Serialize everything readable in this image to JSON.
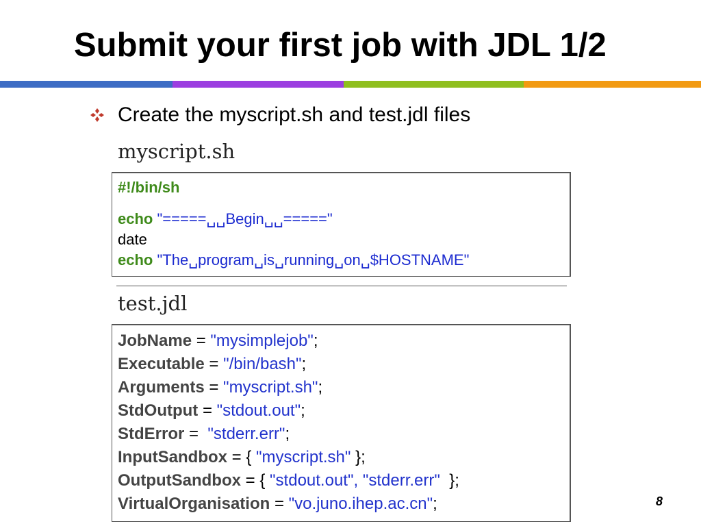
{
  "slide": {
    "title": "Submit your first job with JDL 1/2",
    "bullet": "Create the myscript.sh and test.jdl files",
    "page_number": "8"
  },
  "colors": {
    "bar_blue": "#3d6cc4",
    "bar_purple": "#9b3ee0",
    "bar_green": "#8fbf1e",
    "bar_orange": "#f29a12",
    "bullet_icon": "#c0392b"
  },
  "icons": {
    "bullet": "four-diamond-bullet-icon"
  },
  "myscript": {
    "label": "myscript.sh",
    "shebang": "#!/bin/sh",
    "line1_kw": "echo",
    "line1_str": "\"=====␣␣Begin␣␣=====\"",
    "line2": "date",
    "line3_kw": "echo",
    "line3_str": "\"The␣program␣is␣running␣on␣$HOSTNAME\""
  },
  "jdl": {
    "label": "test.jdl",
    "lines": [
      {
        "key": "JobName",
        "op": " = ",
        "value": "\"mysimplejob\"",
        "end": ";"
      },
      {
        "key": "Executable",
        "op": " = ",
        "value": "\"/bin/bash\"",
        "end": ";"
      },
      {
        "key": "Arguments",
        "op": " = ",
        "value": "\"myscript.sh\"",
        "end": ";"
      },
      {
        "key": "StdOutput",
        "op": " = ",
        "value": "\"stdout.out\"",
        "end": ";"
      },
      {
        "key": "StdError",
        "op": " =  ",
        "value": "\"stderr.err\"",
        "end": ";"
      },
      {
        "key": "InputSandbox",
        "op": " = { ",
        "value": "\"myscript.sh\"",
        "end": " };"
      },
      {
        "key": "OutputSandbox",
        "op": " = { ",
        "value": "\"stdout.out\", \"stderr.err\"",
        "end": "  };"
      },
      {
        "key": "VirtualOrganisation",
        "op": " = ",
        "value": "\"vo.juno.ihep.ac.cn\"",
        "end": ";"
      }
    ]
  }
}
